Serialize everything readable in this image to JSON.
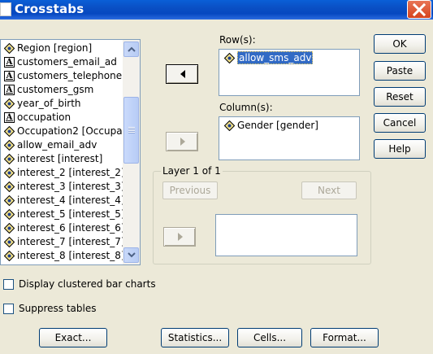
{
  "window": {
    "title": "Crosstabs"
  },
  "variables": [
    {
      "label": "Region [region]",
      "icon": "nominal-icon"
    },
    {
      "label": "customers_email_ad",
      "icon": "string-icon"
    },
    {
      "label": "customers_telephone",
      "icon": "string-icon"
    },
    {
      "label": "customers_gsm",
      "icon": "string-icon"
    },
    {
      "label": "year_of_birth",
      "icon": "nominal-icon"
    },
    {
      "label": "occupation",
      "icon": "string-icon"
    },
    {
      "label": "Occupation2 [Occupa",
      "icon": "nominal-icon"
    },
    {
      "label": "allow_email_adv",
      "icon": "nominal-icon"
    },
    {
      "label": "interest [interest]",
      "icon": "nominal-icon"
    },
    {
      "label": "interest_2 [interest_2]",
      "icon": "nominal-icon"
    },
    {
      "label": "interest_3 [interest_3]",
      "icon": "nominal-icon"
    },
    {
      "label": "interest_4 [interest_4]",
      "icon": "nominal-icon"
    },
    {
      "label": "interest_5 [interest_5]",
      "icon": "nominal-icon"
    },
    {
      "label": "interest_6 [interest_6]",
      "icon": "nominal-icon"
    },
    {
      "label": "interest_7 [interest_7]",
      "icon": "nominal-icon"
    },
    {
      "label": "interest_8 [interest_8]",
      "icon": "nominal-icon"
    }
  ],
  "rows": {
    "label": "Row(s):",
    "items": [
      "allow_sms_adv"
    ]
  },
  "columns": {
    "label": "Column(s):",
    "items": [
      "Gender [gender]"
    ]
  },
  "layer": {
    "title": "Layer 1 of 1",
    "previous": "Previous",
    "next": "Next"
  },
  "buttons": {
    "ok": "OK",
    "paste": "Paste",
    "reset": "Reset",
    "cancel": "Cancel",
    "help": "Help"
  },
  "options": {
    "clustered_bar": {
      "label": "Display clustered bar charts",
      "checked": false
    },
    "suppress_tables": {
      "label": "Suppress tables",
      "checked": false
    }
  },
  "bottom_buttons": {
    "exact": "Exact...",
    "statistics": "Statistics...",
    "cells": "Cells...",
    "format": "Format..."
  },
  "colors": {
    "titlebar": "#0A4FC4",
    "selection": "#316AC5",
    "dialog_bg": "#ECE9D8"
  }
}
